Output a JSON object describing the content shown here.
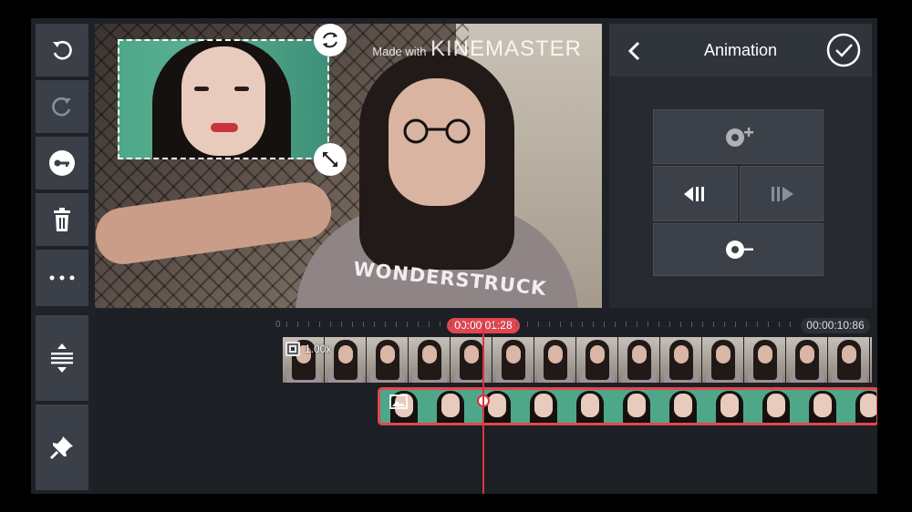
{
  "toolbar": {
    "buttons": [
      {
        "name": "undo",
        "icon": "undo-icon"
      },
      {
        "name": "redo",
        "icon": "redo-icon"
      },
      {
        "name": "keyframe",
        "icon": "key-icon"
      },
      {
        "name": "delete",
        "icon": "trash-icon"
      },
      {
        "name": "more",
        "icon": "more-icon"
      }
    ],
    "bottom": [
      {
        "name": "timeline-expand",
        "icon": "expand-tracks-icon"
      },
      {
        "name": "pin",
        "icon": "pin-icon"
      }
    ]
  },
  "preview": {
    "watermark_small": "Made with",
    "watermark_big": "KINEMASTER",
    "shirt_text": "WONDERSTRUCK",
    "rotate_handle_icon": "rotate-icon",
    "resize_handle_icon": "resize-icon"
  },
  "panel": {
    "title": "Animation",
    "back_icon": "chevron-left-icon",
    "confirm_icon": "checkmark-icon",
    "buttons": [
      {
        "name": "in-animation",
        "icon": "in-animation-icon"
      },
      {
        "name": "prev-keyframe",
        "icon": "prev-keyframe-icon"
      },
      {
        "name": "next-keyframe",
        "icon": "next-keyframe-icon"
      },
      {
        "name": "out-animation",
        "icon": "out-animation-icon"
      }
    ]
  },
  "timeline": {
    "ruler_start": "0",
    "playhead_time": "00:00:01:28",
    "total_time": "00:00:10:86",
    "main_track": {
      "speed": "1.00x"
    },
    "overlay_track": {
      "selected": true
    },
    "colors": {
      "accent": "#e2464f",
      "playhead": "#d9343e"
    }
  }
}
